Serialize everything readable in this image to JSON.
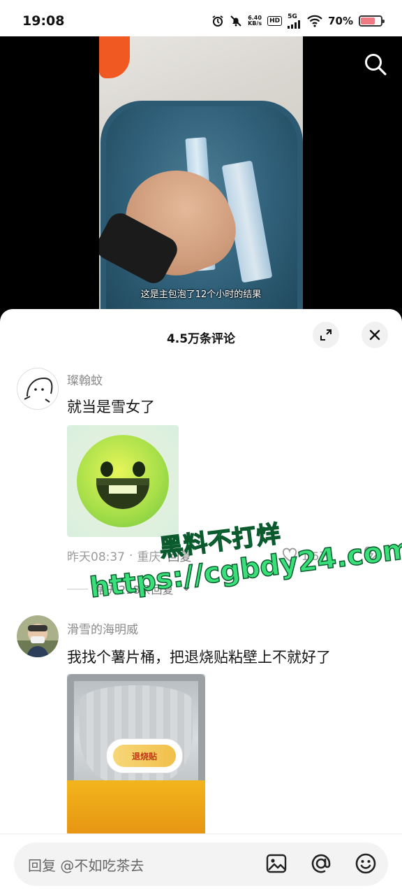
{
  "status_bar": {
    "time": "19:08",
    "net_speed_value": "6.40",
    "net_speed_unit": "KB/s",
    "hd_label": "HD",
    "network_label": "5G",
    "battery_text": "70%",
    "battery_level": 0.7
  },
  "video": {
    "subtitle": "这是主包泡了12个小时的结果"
  },
  "comments_panel": {
    "title": "4.5万条评论",
    "comments": [
      {
        "username": "璨翰蚊",
        "text": "就当是雪女了",
        "time": "昨天08:37",
        "separator": "·",
        "location": "重庆",
        "likes": "1.5万",
        "expand_replies": "展开218条回复"
      },
      {
        "username": "滑雪的海明威",
        "text": "我找个薯片桶，把退烧贴粘壁上不就好了",
        "patch_text": "退烧贴"
      }
    ]
  },
  "watermark": {
    "line1": "黑料不打烊",
    "line2": "https://cgbdy24.com"
  },
  "reply_bar": {
    "placeholder": "回复 @不如吃茶去"
  },
  "colors": {
    "watermark_green": "#39e07a",
    "battery_red": "#f07a84"
  }
}
